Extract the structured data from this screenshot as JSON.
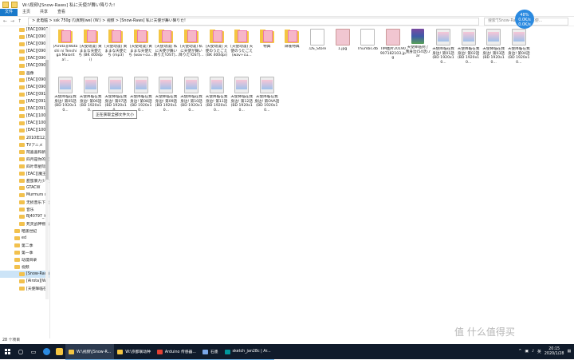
{
  "window": {
    "title": "W:\\视频\\[Snow-Raws] 私に天使が舞い降りた!",
    "ribbon_tabs": [
      "文件",
      "主页",
      "共享",
      "查看"
    ],
    "address": "> 此电脑 > ssk 750g (\\\\真明(we) (W:) > 视频 > [Snow-Raws] 私に天使が舞い降りた!",
    "search_placeholder": "搜索\"[Snow-Raws] 私に天使..."
  },
  "widget": {
    "value": "48",
    "unit": "%",
    "line2": "0.0K/s",
    "line3": "0.0K/s"
  },
  "sidebar": {
    "items": [
      "[EAC][0906",
      "[EAC][0906",
      "[EAC][0907",
      "[EAC][0908",
      "[EAC][0908",
      "[EAC][0908",
      "画像",
      "[EAC][0908",
      "[EAC][0909",
      "[EAC][0910",
      "[EAC][0910",
      "[EAC][0911",
      "[EAC][1002",
      "[EAC][1003",
      "[EAC][1003",
      "2010年12月",
      "TVアニメ 『",
      "阿喜喜和新",
      "四月是你的谎",
      "四叶草星际",
      "[EAC][魔王]",
      "甜蜜暴力少女",
      "GTACW",
      "Murmurs of",
      "无损音乐下载",
      "音乐",
      "BJ40797_k",
      "死灵战神物语",
      "暗黑世纪",
      "ed",
      "第二季",
      "第一季",
      "动漫目录",
      "视频",
      "[Snow-Raws",
      "[Airota][Wa",
      "[天使降临在"
    ],
    "selected_index": 34
  },
  "files": [
    {
      "label": "[Airota][Watashi ni Tenshi ga Maiorita!...",
      "type": "folder"
    },
    {
      "label": "[天使动漫] 黄ままな天使たち (BK 400dpi)",
      "type": "folder"
    },
    {
      "label": "[天使动漫] 黄ままな天使たち (mp3)",
      "type": "folder"
    },
    {
      "label": "[天使动漫] 黄ままな天使たち (wav+cu...",
      "type": "folder"
    },
    {
      "label": "[天使动漫] 私に天使が舞い降りた!OST]...",
      "type": "folder"
    },
    {
      "label": "[天使动漫] 私に天使が舞い降りた!OST]...",
      "type": "folder"
    },
    {
      "label": "[天使动漫] 天使のうたごえ (BK 400dpi)",
      "type": "folder"
    },
    {
      "label": "[天使动漫] 天使のうたごえ (wav+cu...",
      "type": "folder"
    },
    {
      "label": "特典",
      "type": "folder"
    },
    {
      "label": "麻雀特典",
      "type": "folder"
    },
    {
      "label": ".DS_Store",
      "type": "doc"
    },
    {
      "label": "1.jpg",
      "type": "img"
    },
    {
      "label": "Thumbs.db",
      "type": "doc"
    },
    {
      "label": "TIM图片20190907182103.jpg",
      "type": "img"
    },
    {
      "label": "天使降临到了我身边(54话).rar",
      "type": "rar"
    },
    {
      "label": "天使降临在我身边! 第01話(BD 1920x10...",
      "type": "vid"
    },
    {
      "label": "天使降临在我身边! 第02話(BD 1920x10...",
      "type": "vid"
    },
    {
      "label": "天使降临在我身边! 第03話(BD 1920x10...",
      "type": "vid"
    },
    {
      "label": "天使降临在我身边! 第04話(BD 1920x10...",
      "type": "vid"
    },
    {
      "label": "天使降临在我身边! 第05話(BD 1920x10...",
      "type": "vid"
    },
    {
      "label": "天使降临在我身边! 第06話(BD 1920x10...",
      "type": "vid"
    },
    {
      "label": "天使降临在我身边! 第07話(BD 1920x10...",
      "type": "vid"
    },
    {
      "label": "天使降临在我身边! 第08話(BD 1920x10...",
      "type": "vid"
    },
    {
      "label": "天使降临在我身边! 第09話(BD 1920x10...",
      "type": "vid"
    },
    {
      "label": "天使降临在我身边! 第10話(BD 1920x10...",
      "type": "vid"
    },
    {
      "label": "天使降临在我身边! 第11話(BD 1920x10...",
      "type": "vid"
    },
    {
      "label": "天使降临在我身边! 第12話(BD 1920x10...",
      "type": "vid"
    },
    {
      "label": "天使降临在我身边! 第OVA話(BD 1920x10...",
      "type": "vid"
    }
  ],
  "tooltip": "正在获取全部文件大小",
  "status": "28 个项目",
  "taskbar": {
    "apps": [
      {
        "label": "W:\\视频\\[Snow-R...",
        "color": "#f4c542",
        "active": true
      },
      {
        "label": "W:\\京都联动种",
        "color": "#f4c542",
        "active": false
      },
      {
        "label": "Arduino 传感器...",
        "color": "#e34133",
        "active": false
      },
      {
        "label": "石墨",
        "color": "#7aa7e8",
        "active": false
      },
      {
        "label": "sketch_jan28c | Ar...",
        "color": "#00979c",
        "active": false
      }
    ],
    "time": "20:15",
    "date": "2020/1/28",
    "ime": "英"
  },
  "watermark": "值 什么值得买"
}
